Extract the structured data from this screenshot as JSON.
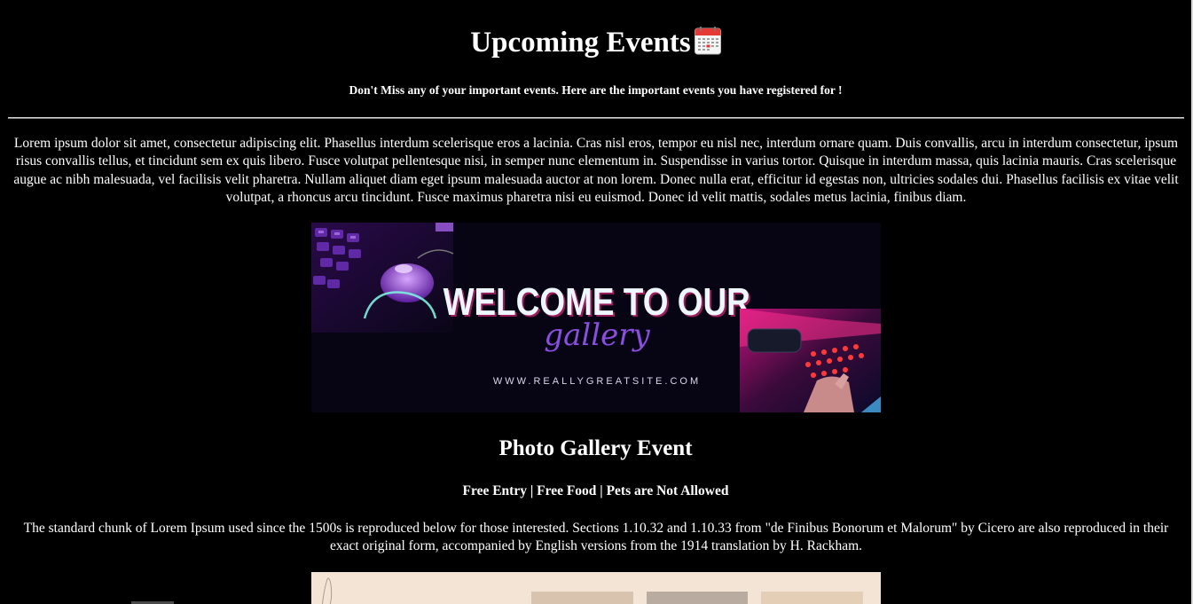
{
  "header": {
    "title": "Upcoming Events",
    "title_icon": "calendar-icon",
    "subtitle": "Don't Miss any of your important events. Here are the important events you have registered for !"
  },
  "intro": {
    "text": "Lorem ipsum dolor sit amet, consectetur adipiscing elit. Phasellus interdum scelerisque eros a lacinia. Cras nisl eros, tempor eu nisl nec, interdum ornare quam. Duis convallis, arcu in interdum consectetur, ipsum risus convallis tellus, et tincidunt sem ex quis libero. Fusce volutpat pellentesque nisi, in semper nunc elementum in. Suspendisse in varius tortor. Quisque in interdum massa, quis lacinia mauris. Cras scelerisque augue ac nibh malesuada, vel facilisis velit pharetra. Nullam aliquet diam eget ipsum malesuada auctor at non lorem. Donec nulla erat, efficitur id egestas non, ultricies sodales dui. Phasellus facilisis ex vitae velit volutpat, a rhoncus arcu tincidunt. Fusce maximus pharetra nisi eu euismod. Donec id velit mattis, sodales metus lacinia, finibus diam."
  },
  "banner": {
    "headline": "WELCOME TO OUR",
    "script": "gallery",
    "website": "WWW.REALLYGREATSITE.COM"
  },
  "event": {
    "title": "Photo Gallery Event",
    "tags": "Free Entry | Free Food | Pets are Not Allowed",
    "description": "The standard chunk of Lorem Ipsum used since the 1500s is reproduced below for those interested. Sections 1.10.32 and 1.10.33 from \"de Finibus Bonorum et Malorum\" by Cicero are also reproduced in their exact original form, accompanied by English versions from the 1914 translation by H. Rackham."
  },
  "colors": {
    "background": "#000000",
    "text": "#ffffff",
    "banner_bg": "#070414",
    "neon_purple": "#9b5cf0",
    "neon_pink": "#ff2f8e",
    "next_image_bg": "#f4e4d6"
  }
}
